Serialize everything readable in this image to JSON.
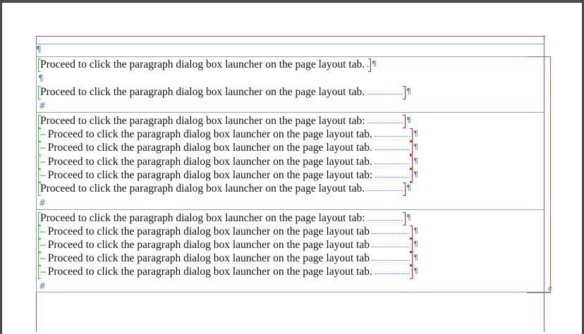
{
  "markers": {
    "pilcrow": "¶",
    "hash": "#"
  },
  "sections": [
    {
      "lines": [
        {
          "text": "Proceed to click the paragraph dialog box launcher on the page layout tab.",
          "indent": false
        },
        {
          "text": "Proceed to click the paragraph dialog box launcher on the page layout tab.",
          "indent": false
        }
      ]
    },
    {
      "lines": [
        {
          "text": "Proceed to click the paragraph dialog box launcher on the page layout tab:",
          "indent": false
        },
        {
          "text": "Proceed to click the paragraph dialog box launcher on the page layout tab.",
          "indent": true
        },
        {
          "text": "Proceed to click the paragraph dialog box launcher on the page layout tab.",
          "indent": true
        },
        {
          "text": "Proceed to click the paragraph dialog box launcher on the page layout tab.",
          "indent": true
        },
        {
          "text": "Proceed to click the paragraph dialog box launcher on the page layout tab:",
          "indent": true
        },
        {
          "text": "Proceed to click the paragraph dialog box launcher on the page layout tab.",
          "indent": false
        }
      ]
    },
    {
      "lines": [
        {
          "text": "Proceed to click the paragraph dialog box launcher on the page layout tab:",
          "indent": false
        },
        {
          "text": "Proceed to click the paragraph dialog box launcher on the page layout tab",
          "indent": true
        },
        {
          "text": "Proceed to click the paragraph dialog box launcher on the page layout tab",
          "indent": true
        },
        {
          "text": "Proceed to click the paragraph dialog box launcher on the page layout tab",
          "indent": true
        },
        {
          "text": "Proceed to click the paragraph dialog box launcher on the page layout tab.",
          "indent": true
        }
      ]
    }
  ],
  "colors": {
    "margin_guide": "#c040c0",
    "frame_edge": "#8aa2c8",
    "hidden_chars": "#4b7fd1",
    "start_bracket": "#2ecc40",
    "end_bracket": "#e0201a",
    "frame_corner": "#c0603a"
  }
}
